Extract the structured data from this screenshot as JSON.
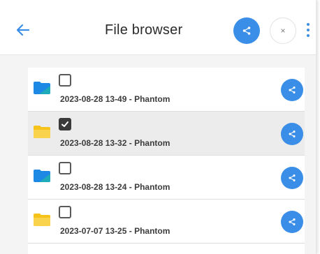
{
  "header": {
    "title": "File browser",
    "close_label": "×"
  },
  "colors": {
    "accent": "#3a8ee8",
    "folder_blue": "#1e88e5",
    "folder_yellow": "#f6c31a"
  },
  "files": [
    {
      "name": "2023-08-28 13-49 - Phantom",
      "folder_icon": "folder-blue-icon",
      "checked": false
    },
    {
      "name": "2023-08-28 13-32 - Phantom",
      "folder_icon": "folder-yellow-icon",
      "checked": true
    },
    {
      "name": "2023-08-28 13-24 - Phantom",
      "folder_icon": "folder-blue-icon",
      "checked": false
    },
    {
      "name": "2023-07-07 13-25 - Phantom",
      "folder_icon": "folder-yellow-icon",
      "checked": false
    }
  ]
}
